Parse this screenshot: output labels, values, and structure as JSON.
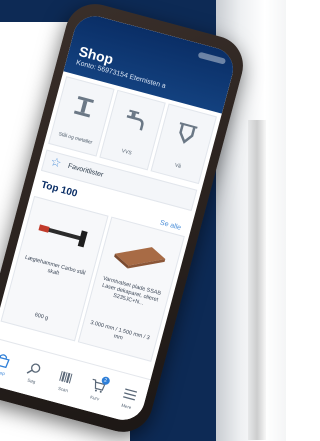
{
  "app": {
    "title": "Shop",
    "account": "Konto: 56973154 Eternisten a"
  },
  "categories": [
    {
      "label": "Stål og metaller",
      "icon": "steel-beam-icon"
    },
    {
      "label": "VVS",
      "icon": "faucet-icon"
    },
    {
      "label": "Vå",
      "icon": "pipe-icon"
    }
  ],
  "favorites": {
    "label": "Favoritlister",
    "icon": "star-icon"
  },
  "top": {
    "title": "Top 100",
    "see_all": "Se alle"
  },
  "products": [
    {
      "name": "Lægtehammer Carbo stål skaft",
      "meta": "600 g",
      "image": "hammer-icon"
    },
    {
      "name": "Varmtvalset plade SSAB Laser dekaparet, olieret S235JC+N...",
      "meta": "3.000 mm / 1.500 mm / 3 mm",
      "image": "steel-plate-icon"
    }
  ],
  "nav": [
    {
      "label": "Shop",
      "icon": "shop-icon",
      "active": true
    },
    {
      "label": "Søg",
      "icon": "search-icon",
      "active": false
    },
    {
      "label": "Scan",
      "icon": "barcode-icon",
      "active": false
    },
    {
      "label": "Kurv",
      "icon": "cart-icon",
      "active": false,
      "badge": "2"
    },
    {
      "label": "Mere",
      "icon": "menu-icon",
      "active": false
    }
  ],
  "colors": {
    "brand": "#0a2e66",
    "accent": "#2f7fd8",
    "background_navy": "#0d2a55"
  }
}
